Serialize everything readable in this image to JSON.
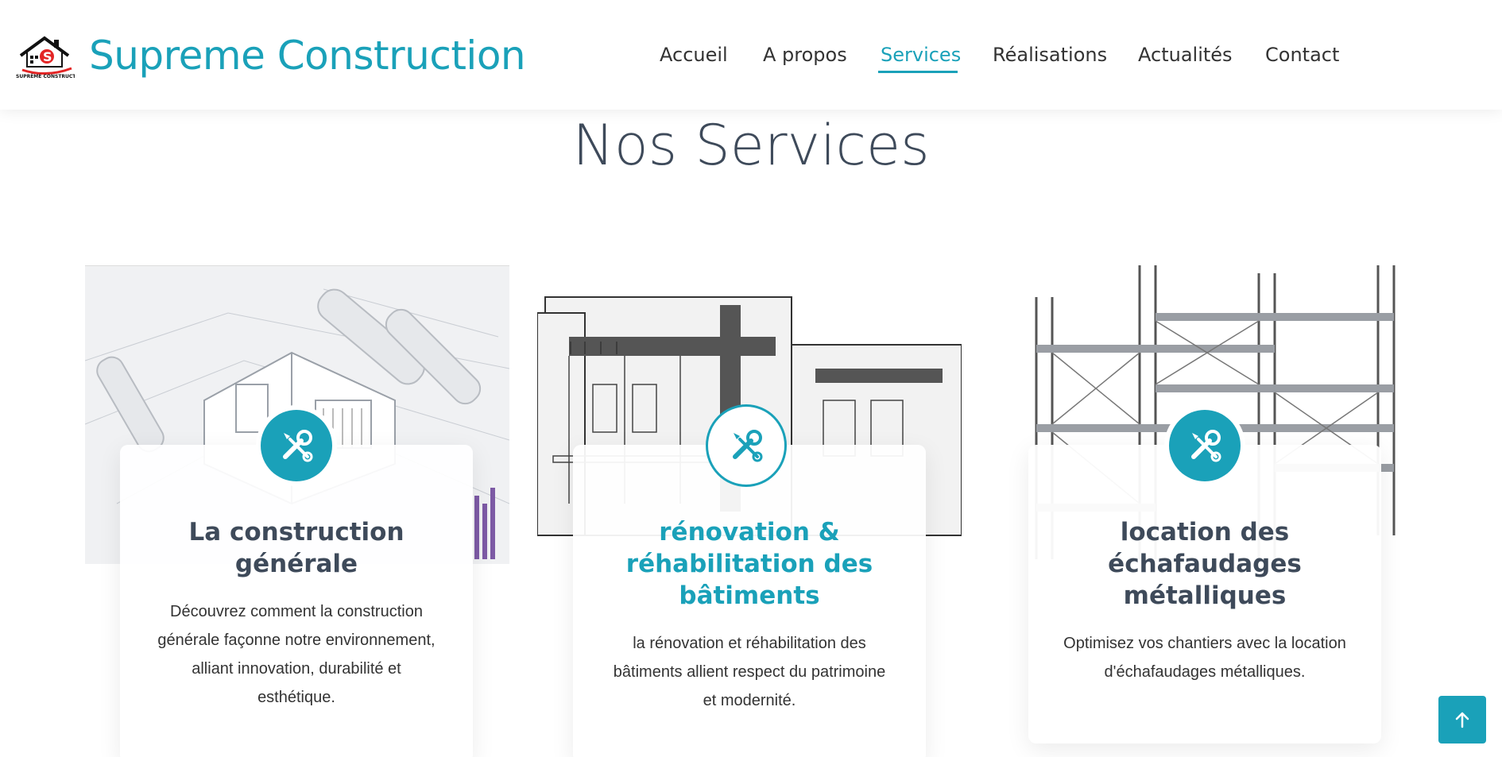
{
  "header": {
    "brand_name": "Supreme Construction",
    "logo_text": "SUPRÊME CONSTRUCTION",
    "nav": [
      {
        "label": "Accueil",
        "active": false
      },
      {
        "label": "A propos",
        "active": false
      },
      {
        "label": "Services",
        "active": true
      },
      {
        "label": "Réalisations",
        "active": false
      },
      {
        "label": "Actualités",
        "active": false
      },
      {
        "label": "Contact",
        "active": false
      }
    ]
  },
  "section": {
    "title": "Nos Services"
  },
  "services": [
    {
      "title": "La construction générale",
      "description": "Découvrez comment la construction générale façonne notre environnement, alliant innovation, durabilité et esthétique.",
      "icon": "tools-icon"
    },
    {
      "title": "rénovation & réhabilitation des bâtiments",
      "description": "la rénovation et réhabilitation des bâtiments allient respect du patrimoine et modernité.",
      "icon": "tools-icon"
    },
    {
      "title": "location des échafaudages métalliques",
      "description": "Optimisez vos chantiers avec la location d'échafaudages métalliques.",
      "icon": "tools-icon"
    }
  ],
  "colors": {
    "accent": "#1aa1b9",
    "heading": "#3e4a5a",
    "text": "#333333"
  },
  "back_to_top": {
    "icon": "arrow-up-icon"
  }
}
